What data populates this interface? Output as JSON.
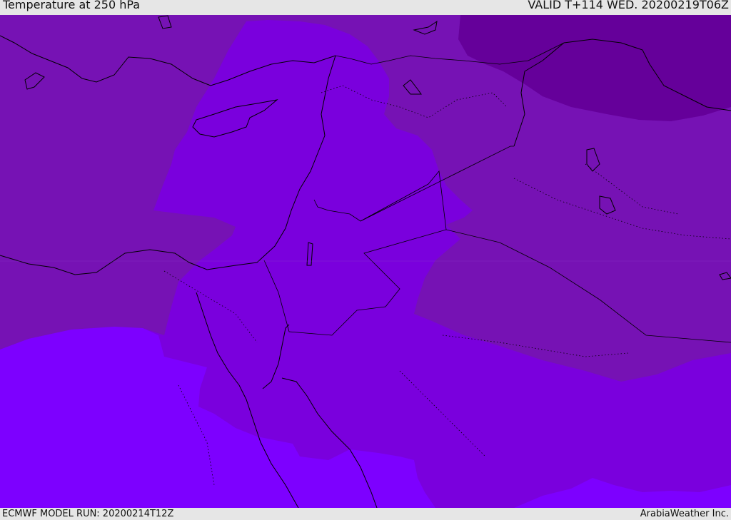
{
  "header": {
    "title": "Temperature at 250 hPa",
    "valid": "VALID T+114 WED. 20200219T06Z"
  },
  "footer": {
    "model_run": "ECMWF MODEL RUN: 20200214T12Z",
    "credit": "ArabiaWeather Inc."
  },
  "map": {
    "colors": {
      "darkest": "#65009a",
      "dark": "#7612b4",
      "mid": "#7a00dd",
      "light": "#7d00ff",
      "coast": "#000000"
    }
  }
}
